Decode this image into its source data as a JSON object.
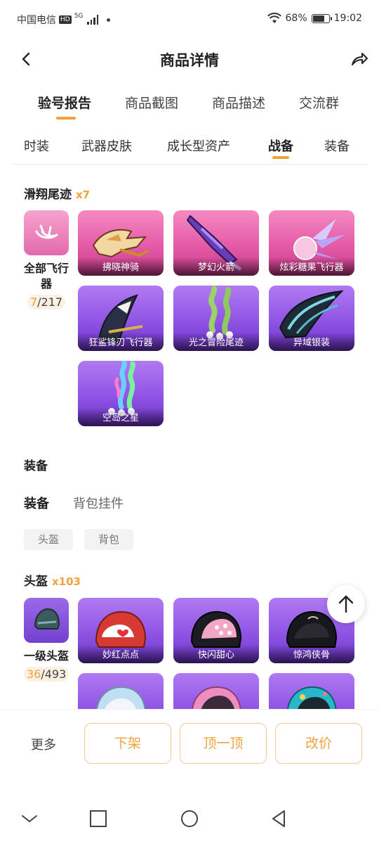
{
  "status_bar": {
    "carrier": "中国电信",
    "hd": "HD",
    "net": "5G",
    "battery_pct": "68%",
    "battery_level": 0.68,
    "time": "19:02"
  },
  "header": {
    "title": "商品详情"
  },
  "main_tabs": [
    {
      "label": "验号报告",
      "active": true
    },
    {
      "label": "商品截图",
      "active": false
    },
    {
      "label": "商品描述",
      "active": false
    },
    {
      "label": "交流群",
      "active": false
    }
  ],
  "sub_tabs": [
    {
      "label": "时装",
      "active": false
    },
    {
      "label": "武器皮肤",
      "active": false
    },
    {
      "label": "成长型资产",
      "active": false
    },
    {
      "label": "战备",
      "active": true
    },
    {
      "label": "装备",
      "active": false
    }
  ],
  "glide_section": {
    "title": "滑翔尾迹",
    "count": "x7",
    "all_card": {
      "label": "全部飞行器",
      "owned": "7",
      "total": "/217"
    },
    "items": [
      {
        "label": "拂晓神骑",
        "icon": "golden-griffin-glider"
      },
      {
        "label": "梦幻火箭",
        "icon": "purple-rocket-glider"
      },
      {
        "label": "炫彩糖果飞行器",
        "icon": "candy-glider"
      },
      {
        "label": "狂鲨锋刃飞行器",
        "icon": "shark-glider"
      },
      {
        "label": "光之冒险尾迹",
        "icon": "green-smoke-trail"
      },
      {
        "label": "异域银装",
        "icon": "silver-wing-glider"
      },
      {
        "label": "空岛之星",
        "icon": "rainbow-smoke-trail"
      }
    ]
  },
  "equipment_section": {
    "title": "装备",
    "filter_tabs": [
      {
        "label": "装备",
        "active": true
      },
      {
        "label": "背包挂件",
        "active": false
      }
    ],
    "chips": [
      "头盔",
      "背包"
    ]
  },
  "helmet_section": {
    "title": "头盔",
    "count": "x103",
    "all_card": {
      "label": "一级头盔",
      "owned": "36",
      "total": "/493"
    },
    "items": [
      {
        "label": "妙红点点",
        "icon": "red-heart-helmet"
      },
      {
        "label": "快闪甜心",
        "icon": "pink-dot-helmet"
      },
      {
        "label": "惊鸿侠骨",
        "icon": "black-helmet"
      },
      {
        "label": "",
        "icon": "light-blue-helmet"
      },
      {
        "label": "",
        "icon": "pink-star-helmet"
      },
      {
        "label": "",
        "icon": "teal-sticker-helmet"
      }
    ]
  },
  "action_bar": {
    "more": "更多",
    "buttons": [
      "下架",
      "顶一顶",
      "改价"
    ]
  },
  "nav_bar": {
    "icons": [
      "collapse-icon",
      "recent-apps-icon",
      "home-icon",
      "back-nav-icon"
    ]
  },
  "colors": {
    "accent": "#f3a23b",
    "pink_tile": "#e45aa6",
    "purple_tile": "#8e54e4"
  }
}
